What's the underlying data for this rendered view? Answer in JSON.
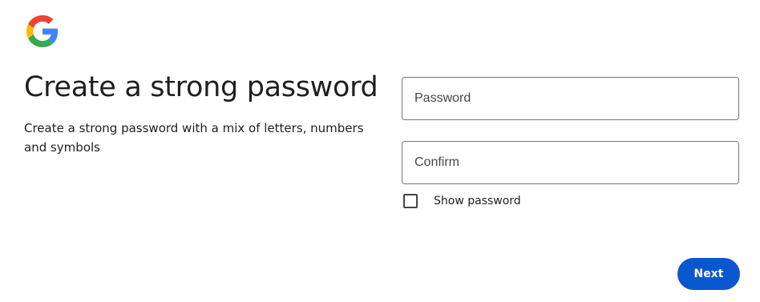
{
  "brand": {
    "logo_icon": "google-g-icon",
    "colors": {
      "blue": "#4285F4",
      "red": "#EA4335",
      "yellow": "#FBBC05",
      "green": "#34A853"
    }
  },
  "heading": {
    "title": "Create a strong password",
    "subtitle": "Create a strong password with a mix of letters, numbers and symbols"
  },
  "form": {
    "password": {
      "placeholder": "Password",
      "value": ""
    },
    "confirm": {
      "placeholder": "Confirm",
      "value": ""
    },
    "show_password": {
      "label": "Show password",
      "checked": false
    }
  },
  "actions": {
    "next_label": "Next",
    "accent_color": "#0b57d0"
  }
}
